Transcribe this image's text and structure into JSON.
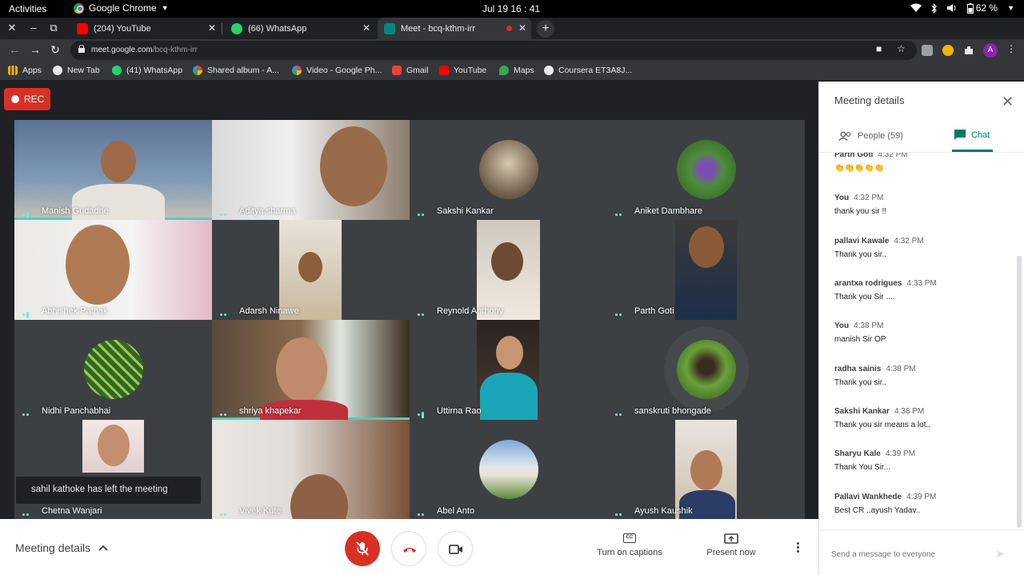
{
  "system": {
    "activities": "Activities",
    "app_name": "Google Chrome",
    "clock": "Jul 19  16 : 41",
    "battery": "62 %"
  },
  "tabs": [
    {
      "title": "(204) YouTube",
      "color": "#ff0000"
    },
    {
      "title": "(66) WhatsApp",
      "color": "#25d366"
    },
    {
      "title": "Meet - bcq-kthm-irr",
      "color": "#00897b"
    }
  ],
  "address": {
    "domain": "meet.google.com",
    "path": "/bcq-kthm-irr"
  },
  "bookmarks": [
    {
      "label": "Apps",
      "color": "#f4b400"
    },
    {
      "label": "New Tab",
      "color": "#e8eaed"
    },
    {
      "label": "(41) WhatsApp",
      "color": "#25d366"
    },
    {
      "label": "Shared album - A...",
      "color": "#fbbc04"
    },
    {
      "label": "Video - Google Ph...",
      "color": "#ea4335"
    },
    {
      "label": "Gmail",
      "color": "#ea4335"
    },
    {
      "label": "YouTube",
      "color": "#ff0000"
    },
    {
      "label": "Maps",
      "color": "#34a853"
    },
    {
      "label": "Coursera ET3A8J...",
      "color": "#e8eaed"
    }
  ],
  "meeting": {
    "rec_label": "REC",
    "participants": [
      "Manish Gudadhe",
      "Aditya sharma",
      "Sakshi Kankar",
      "Aniket Dambhare",
      "Abhishek Pathak",
      "Adarsh Ninawe",
      "Reynold Anthony",
      "Parth Goti",
      "Nidhi Panchabhai",
      "shriya khapekar",
      "Uttirna Rao",
      "sanskruti bhongade",
      "Chetna Wanjari",
      "Vivek Kute",
      "Abel Anto",
      "Ayush Kaushik"
    ],
    "toast": "sahil kathoke has left the meeting"
  },
  "bottom_bar": {
    "meeting_details": "Meeting details",
    "captions": "Turn on captions",
    "present": "Present now",
    "cc_glyph": "CC"
  },
  "panel": {
    "title": "Meeting details",
    "people_tab": "People (59)",
    "chat_tab": "Chat",
    "messages": [
      {
        "sender": "Parth Goti",
        "time": "4:32 PM",
        "text": "👏👏👏👏👏"
      },
      {
        "sender": "You",
        "time": "4:32 PM",
        "text": "thank you sir !!"
      },
      {
        "sender": "pallavi Kawale",
        "time": "4:32 PM",
        "text": "Thank you sir.."
      },
      {
        "sender": "arantxa rodrigues",
        "time": "4:33 PM",
        "text": "Thank you Sir ...."
      },
      {
        "sender": "You",
        "time": "4:38 PM",
        "text": "manish Sir OP"
      },
      {
        "sender": "radha sainis",
        "time": "4:38 PM",
        "text": "Thank you sir.."
      },
      {
        "sender": "Sakshi Kankar",
        "time": "4:38 PM",
        "text": "Thank you sir means a lot.."
      },
      {
        "sender": "Sharyu Kale",
        "time": "4:39 PM",
        "text": "Thank You Sir..."
      },
      {
        "sender": "Pallavi Wankhede",
        "time": "4:39 PM",
        "text": "Best CR ..ayush Yadav.."
      }
    ],
    "input_placeholder": "Send a message to everyone"
  }
}
